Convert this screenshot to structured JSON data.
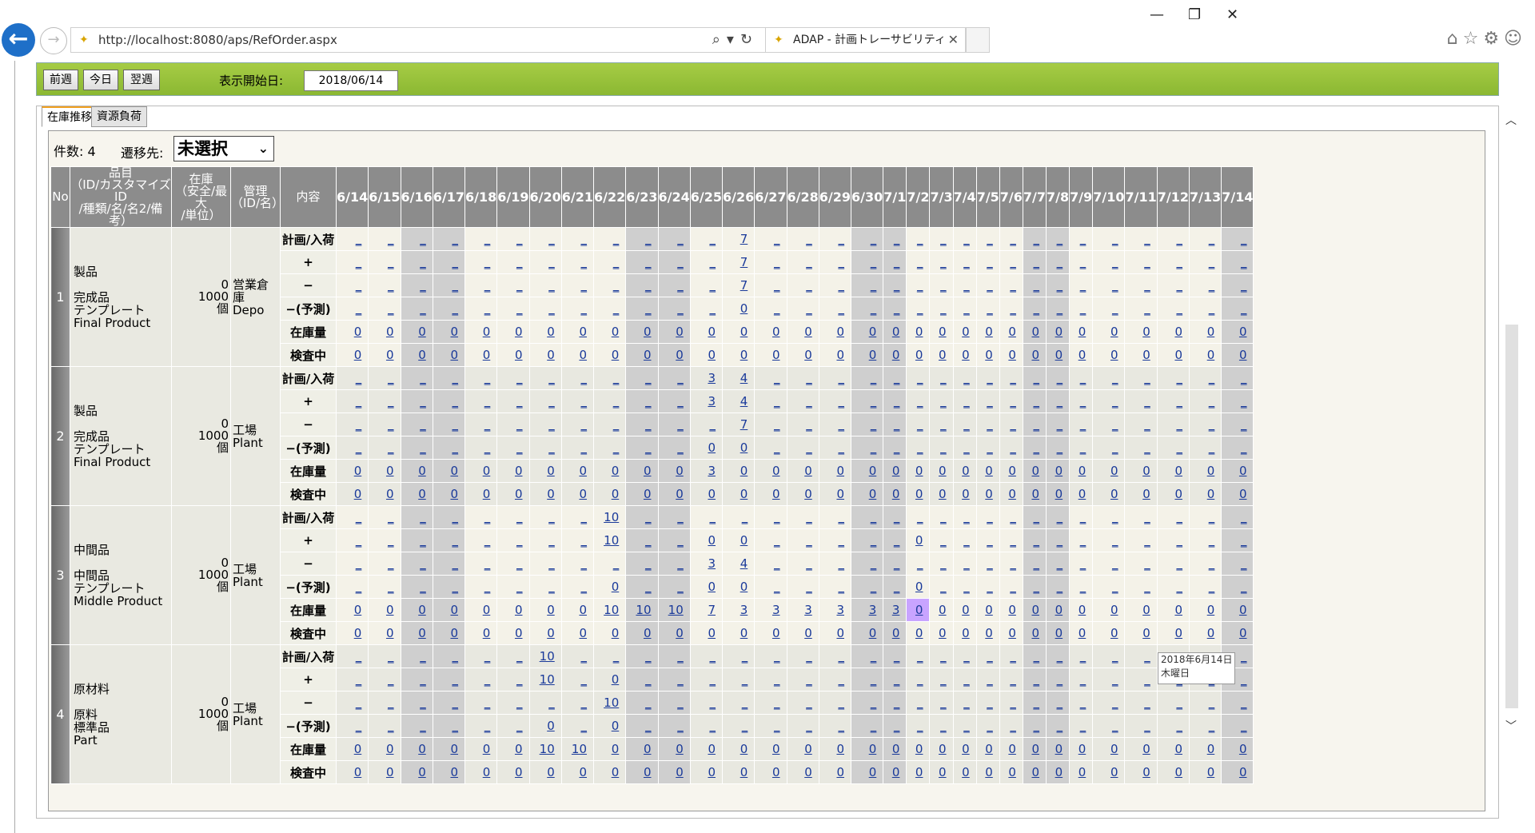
{
  "browser": {
    "url": "http://localhost:8080/aps/RefOrder.aspx",
    "tab_title": "ADAP - 計画トレーサビリティ",
    "minimize": "—",
    "restore": "❐",
    "close": "✕"
  },
  "toolbar": {
    "prev_week": "前週",
    "today": "今日",
    "next_week": "翌週",
    "start_date_label": "表示開始日:",
    "start_date": "2018/06/14"
  },
  "tabs": [
    "在庫推移",
    "資源負荷"
  ],
  "info": {
    "count_label": "件数: 4",
    "dest_label": "遷移先:",
    "dest_value": "未選択"
  },
  "headers": {
    "no": "No",
    "item": "品目\n（ID/カスタマイズID\n/種類/名/名2/備考）",
    "stock": "在庫\n（安全/最大\n/単位）",
    "manage": "管理\n（ID/名）",
    "content": "内容"
  },
  "dates": [
    "6/14",
    "6/15",
    "6/16",
    "6/17",
    "6/18",
    "6/19",
    "6/20",
    "6/21",
    "6/22",
    "6/23",
    "6/24",
    "6/25",
    "6/26",
    "6/27",
    "6/28",
    "6/29",
    "6/30",
    "7/1",
    "7/2",
    "7/3",
    "7/4",
    "7/5",
    "7/6",
    "7/7",
    "7/8",
    "7/9",
    "7/10",
    "7/11",
    "7/12",
    "7/13",
    "7/14"
  ],
  "weekend_idx": [
    2,
    3,
    9,
    10,
    16,
    17,
    23,
    24,
    30
  ],
  "row_kinds": [
    "計画/入荷",
    "+",
    "−",
    "−(予測)",
    "在庫量",
    "検査中"
  ],
  "items": [
    {
      "no": "1",
      "lines": [
        "製品",
        "",
        "完成品",
        "テンプレート",
        "Final Product"
      ],
      "stock": [
        "0",
        "1000",
        "個"
      ],
      "manage": [
        "営業倉庫",
        "Depo"
      ],
      "rows": [
        {
          "12": "7"
        },
        {
          "12": "7"
        },
        {
          "12": "7"
        },
        {
          "12": "0"
        },
        {
          "all": "0"
        },
        {
          "all": "0"
        }
      ]
    },
    {
      "no": "2",
      "lines": [
        "製品",
        "",
        "完成品",
        "テンプレート",
        "Final Product"
      ],
      "stock": [
        "0",
        "1000",
        "個"
      ],
      "manage": [
        "工場",
        "Plant"
      ],
      "rows": [
        {
          "11": "3",
          "12": "4"
        },
        {
          "11": "3",
          "12": "4"
        },
        {
          "12": "7"
        },
        {
          "11": "0",
          "12": "0"
        },
        {
          "all": "0",
          "11": "3"
        },
        {
          "all": "0"
        }
      ]
    },
    {
      "no": "3",
      "lines": [
        "中間品",
        "",
        "中間品",
        "テンプレート",
        "Middle Product"
      ],
      "stock": [
        "0",
        "1000",
        "個"
      ],
      "manage": [
        "工場",
        "Plant"
      ],
      "rows": [
        {
          "8": "10"
        },
        {
          "8": "10",
          "11": "0",
          "12": "0",
          "18": "0"
        },
        {
          "11": "3",
          "12": "4"
        },
        {
          "8": "0",
          "11": "0",
          "12": "0",
          "18": "0"
        },
        {
          "all": "0",
          "8": "10",
          "9": "10",
          "10": "10",
          "11": "7",
          "12": "3",
          "13": "3",
          "14": "3",
          "15": "3",
          "16": "3",
          "17": "3"
        },
        {
          "all": "0"
        }
      ]
    },
    {
      "no": "4",
      "lines": [
        "原材料",
        "",
        "原料",
        "標準品",
        "Part"
      ],
      "stock": [
        "0",
        "1000",
        "個"
      ],
      "manage": [
        "工場",
        "Plant"
      ],
      "rows": [
        {
          "6": "10"
        },
        {
          "6": "10",
          "8": "0"
        },
        {
          "8": "10"
        },
        {
          "6": "0",
          "8": "0"
        },
        {
          "all": "0",
          "6": "10",
          "7": "10"
        },
        {
          "all": "0"
        }
      ]
    }
  ],
  "highlight": {
    "item": 2,
    "row": 4,
    "col": 18
  },
  "tooltip": {
    "line1": "2018年6月14日",
    "line2": "木曜日"
  }
}
